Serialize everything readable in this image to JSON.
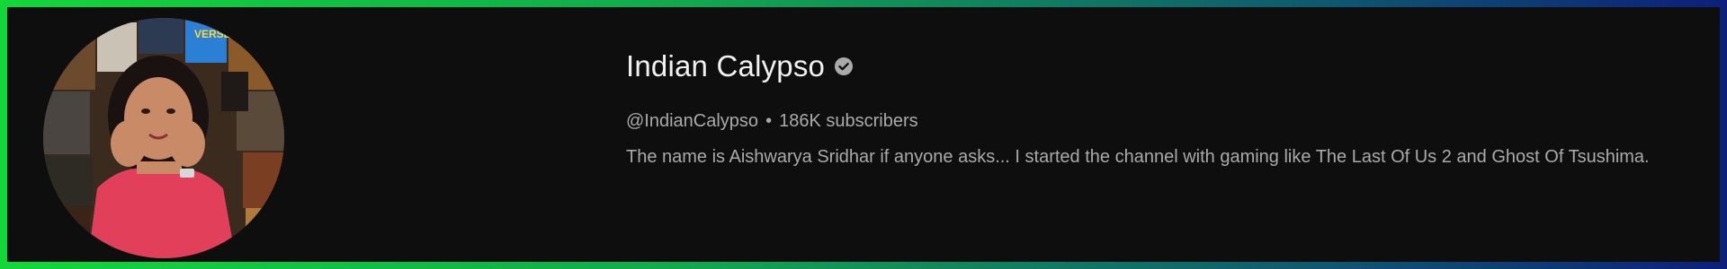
{
  "channel": {
    "name": "Indian Calypso",
    "verified_icon": "verified-check-icon",
    "handle": "@IndianCalypso",
    "separator": "•",
    "subscribers": "186K subscribers",
    "description": "The name is Aishwarya Sridhar if anyone asks... I started the channel with gaming like The Last Of Us 2 and Ghost Of Tsushima."
  },
  "avatar": {
    "icon": "channel-avatar",
    "poster_text": "VERSE"
  },
  "colors": {
    "background": "#0e0e0e",
    "frame_gradient": [
      "#14d63a",
      "#0d1f7a"
    ],
    "name": "#f1f1f1",
    "secondary_text": "#aaaaaa",
    "shirt": "#e2405a"
  }
}
